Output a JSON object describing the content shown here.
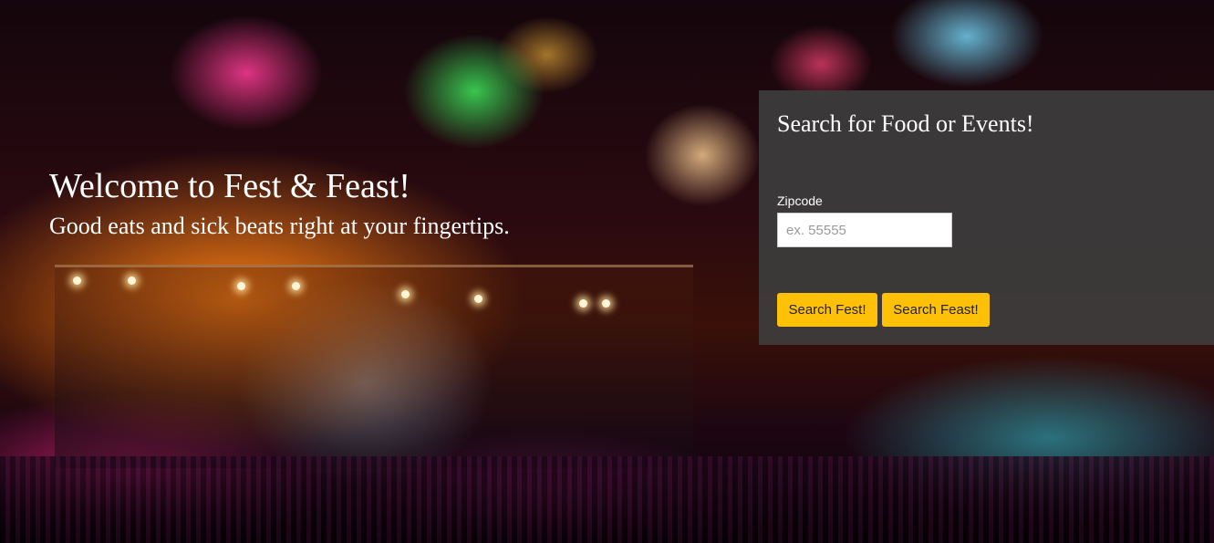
{
  "hero": {
    "title": "Welcome to Fest & Feast!",
    "subtitle": "Good eats and sick beats right at your fingertips."
  },
  "search": {
    "title": "Search for Food or Events!",
    "zipcode_label": "Zipcode",
    "zipcode_placeholder": "ex. 55555",
    "zipcode_value": "",
    "fest_button": "Search Fest!",
    "feast_button": "Search Feast!"
  },
  "colors": {
    "panel_background": "#3c3c3c",
    "button": "#ffc107",
    "text": "#ffffff"
  }
}
